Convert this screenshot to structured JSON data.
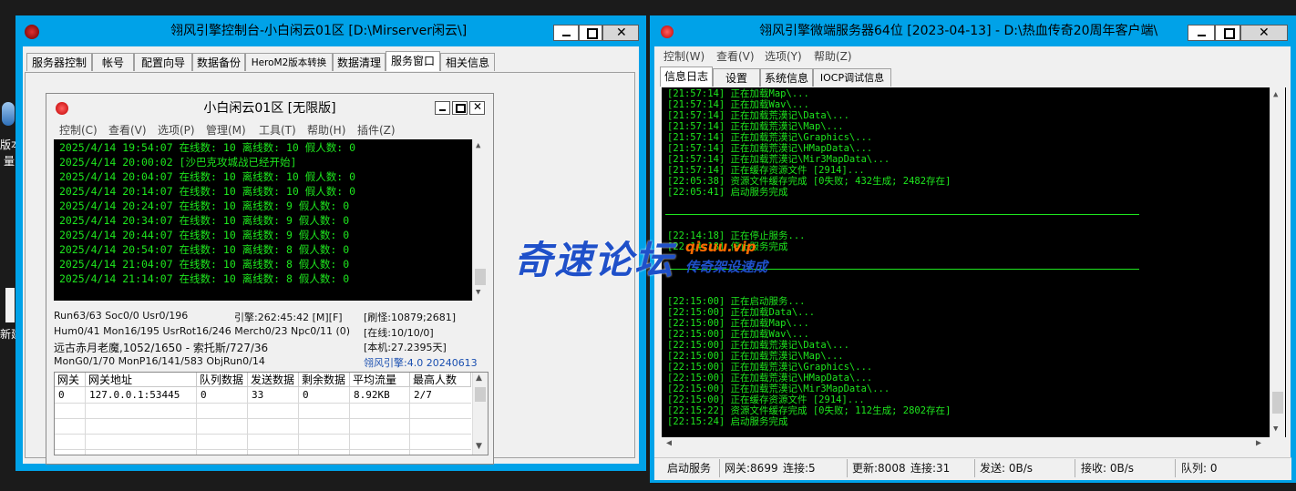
{
  "desktop": {
    "text1": "版本",
    "text2": "量",
    "text3": "新建"
  },
  "left_window": {
    "title": "翎风引擎控制台-小白闲云01区 [D:\\Mirserver闲云\\]",
    "tabs": [
      "服务器控制",
      "帐号",
      "配置向导",
      "数据备份",
      "HeroM2版本转换",
      "数据清理",
      "服务窗口",
      "相关信息"
    ],
    "active_tab": 6,
    "mdi": {
      "title": "小白闲云01区 [无限版]",
      "menu": [
        "控制(C)",
        "查看(V)",
        "选项(P)",
        "管理(M)",
        "工具(T)",
        "帮助(H)",
        "插件(Z)"
      ],
      "log": [
        "2025/4/14 19:54:07 在线数: 10 离线数: 10 假人数: 0",
        "2025/4/14 20:00:02 [沙巴克攻城战已经开始]",
        "2025/4/14 20:04:07 在线数: 10 离线数: 10 假人数: 0",
        "2025/4/14 20:14:07 在线数: 10 离线数: 10 假人数: 0",
        "2025/4/14 20:24:07 在线数: 10 离线数: 9 假人数: 0",
        "2025/4/14 20:34:07 在线数: 10 离线数: 9 假人数: 0",
        "2025/4/14 20:44:07 在线数: 10 离线数: 9 假人数: 0",
        "2025/4/14 20:54:07 在线数: 10 离线数: 8 假人数: 0",
        "2025/4/14 21:04:07 在线数: 10 离线数: 8 假人数: 0",
        "2025/4/14 21:14:07 在线数: 10 离线数: 8 假人数: 0"
      ],
      "stats": {
        "run": "Run63/63 Soc0/0 Usr0/196",
        "engine": "引擎:262:45:42 [M][F]",
        "refresh": "[刷怪:10879;2681]",
        "hum": "Hum0/41 Mon16/195 UsrRot16/246 Merch0/23 Npc0/11 (0)",
        "online": "[在线:10/10/0]",
        "boss": "远古赤月老魔,1052/1650 - 索托斯/727/36",
        "local": "[本机:27.2395天]",
        "mongo": "MonG0/1/70 MonP16/141/583 ObjRun0/14",
        "version": "翎风引擎:4.0 20240613"
      },
      "grid": {
        "headers": [
          "网关",
          "网关地址",
          "队列数据",
          "发送数据",
          "剩余数据",
          "平均流量",
          "最高人数"
        ],
        "rows": [
          [
            "0",
            "127.0.0.1:53445",
            "0",
            "33",
            "0",
            "8.92KB",
            "2/7"
          ]
        ]
      }
    }
  },
  "right_window": {
    "title": "翎风引擎微端服务器64位 [2023-04-13] - D:\\热血传奇20周年客户端\\",
    "menu": [
      "控制(W)",
      "查看(V)",
      "选项(Y)",
      "帮助(Z)"
    ],
    "tabs": [
      "信息日志",
      "设置",
      "系统信息",
      "IOCP调试信息"
    ],
    "active_tab": 0,
    "log": [
      "[21:57:14] 正在加载Map\\...",
      "[21:57:14] 正在加载Wav\\...",
      "[21:57:14] 正在加载荒漠记\\Data\\...",
      "[21:57:14] 正在加载荒漠记\\Map\\...",
      "[21:57:14] 正在加载荒漠记\\Graphics\\...",
      "[21:57:14] 正在加载荒漠记\\HMapData\\...",
      "[21:57:14] 正在加载荒漠记\\Mir3MapData\\...",
      "[21:57:14] 正在缓存资源文件 [2914]...",
      "[22:05:38] 资源文件缓存完成 [0失败; 432生成; 2482存在]",
      "[22:05:41] 启动服务完成",
      "",
      "",
      "",
      "[22:14:18] 正在停止服务...",
      "[22:14:18] 停止服务完成",
      "",
      "",
      "",
      "",
      "[22:15:00] 正在启动服务...",
      "[22:15:00] 正在加载Data\\...",
      "[22:15:00] 正在加载Map\\...",
      "[22:15:00] 正在加载Wav\\...",
      "[22:15:00] 正在加载荒漠记\\Data\\...",
      "[22:15:00] 正在加载荒漠记\\Map\\...",
      "[22:15:00] 正在加载荒漠记\\Graphics\\...",
      "[22:15:00] 正在加载荒漠记\\HMapData\\...",
      "[22:15:00] 正在加载荒漠记\\Mir3MapData\\...",
      "[22:15:00] 正在缓存资源文件 [2914]...",
      "[22:15:22] 资源文件缓存完成 [0失败; 112生成; 2802存在]",
      "[22:15:24] 启动服务完成"
    ],
    "status": {
      "start_btn": "启动服务",
      "gateway": "网关:8699",
      "conn1": "连接:5",
      "update": "更新:8008",
      "conn2": "连接:31",
      "send": "发送: 0B/s",
      "recv": "接收: 0B/s",
      "queue": "队列: 0"
    }
  },
  "watermark": {
    "big": "奇速论坛",
    "url": "qisuu.vip",
    "sub": "传奇架设速成"
  },
  "colors": {
    "titlebar": "#00a2e8",
    "console_bg": "#000000",
    "console_fg": "#1ee61e",
    "watermark_blue": "#1f50c9",
    "watermark_orange": "#ff6a00"
  }
}
